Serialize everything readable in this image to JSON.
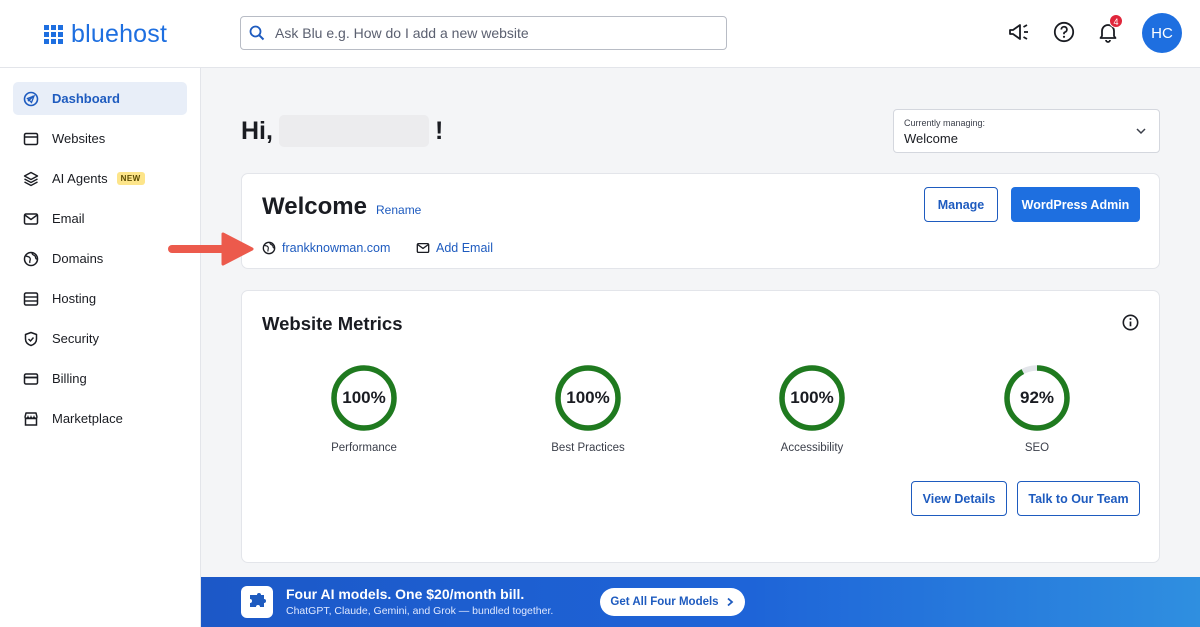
{
  "header": {
    "logo_text": "bluehost",
    "search_placeholder": "Ask Blu e.g. How do I add a new website",
    "notification_count": "4",
    "avatar_initials": "HC"
  },
  "sidebar": {
    "items": [
      {
        "label": "Dashboard",
        "icon": "dashboard-icon",
        "active": true
      },
      {
        "label": "Websites",
        "icon": "browser-window-icon"
      },
      {
        "label": "AI Agents",
        "icon": "layers-icon",
        "badge": "NEW"
      },
      {
        "label": "Email",
        "icon": "mail-icon"
      },
      {
        "label": "Domains",
        "icon": "globe-icon"
      },
      {
        "label": "Hosting",
        "icon": "server-icon"
      },
      {
        "label": "Security",
        "icon": "shield-icon"
      },
      {
        "label": "Billing",
        "icon": "credit-card-icon"
      },
      {
        "label": "Marketplace",
        "icon": "storefront-icon"
      }
    ]
  },
  "main": {
    "greeting_prefix": "Hi,",
    "greeting_suffix": "!",
    "managing_label": "Currently managing:",
    "managing_value": "Welcome"
  },
  "site_card": {
    "title": "Welcome",
    "rename_label": "Rename",
    "domain": "frankknowman.com",
    "add_email_label": "Add Email",
    "manage_label": "Manage",
    "wp_admin_label": "WordPress Admin"
  },
  "metrics": {
    "title": "Website Metrics",
    "items": [
      {
        "label": "Performance",
        "value": "100%",
        "score": 100
      },
      {
        "label": "Best Practices",
        "value": "100%",
        "score": 100
      },
      {
        "label": "Accessibility",
        "value": "100%",
        "score": 100
      },
      {
        "label": "SEO",
        "value": "92%",
        "score": 92
      }
    ],
    "view_details_label": "View Details",
    "talk_label": "Talk to Our Team",
    "gauge_color": "#1f7a1f"
  },
  "banner": {
    "title": "Four AI models. One $20/month bill.",
    "subtitle": "ChatGPT, Claude, Gemini, and Grok — bundled together.",
    "button_label": "Get All Four Models"
  }
}
